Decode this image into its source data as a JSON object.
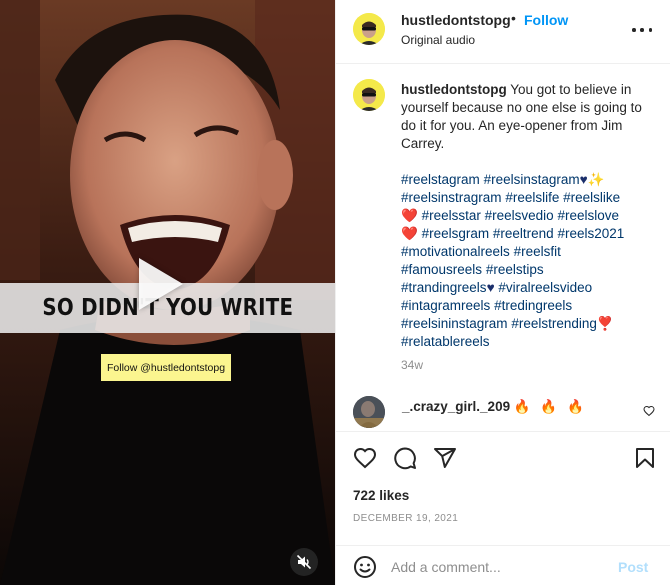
{
  "video": {
    "caption": "SO DIDN'T YOU WRITE",
    "watermark": "Follow @hustledontstopg",
    "play_icon": "play-icon",
    "mute_icon": "muted-speaker-icon"
  },
  "header": {
    "username": "hustledontstopg",
    "separator": "•",
    "follow_label": "Follow",
    "audio_label": "Original audio",
    "more_icon": "more-options-icon"
  },
  "caption": {
    "username": "hustledontstopg",
    "text": "You got to believe in yourself because no one else is going to do it for you. An eye-opener from Jim Carrey.",
    "hashtags": [
      "#reelstagram",
      "#reelsinstagram",
      "♥",
      "✨",
      "#reelsinstragram",
      "#reelslife",
      "#reelslike",
      "❤️",
      "#reelsstar",
      "#reelsvedio",
      "#reelslove",
      "❤️",
      "#reelsgram",
      "#reeltrend",
      "#reels2021",
      "#motivationalreels",
      "#reelsfit",
      "#famousreels",
      "#reelstips",
      "#trandingreels",
      "♥",
      "#viralreelsvideo",
      "#intagramreels",
      "#tredingreels",
      "#reelsininstagram",
      "#reelstrending",
      "❣️",
      "#relatablereels"
    ],
    "age": "34w"
  },
  "comment": {
    "username": "_.crazy_girl._209",
    "text": "🔥 🔥 🔥"
  },
  "actions": {
    "like_icon": "heart-icon",
    "comment_icon": "comment-icon",
    "share_icon": "share-icon",
    "save_icon": "bookmark-icon",
    "likes": "722 likes",
    "date": "DECEMBER 19, 2021"
  },
  "add_comment": {
    "emoji_icon": "emoji-icon",
    "placeholder": "Add a comment...",
    "post_label": "Post"
  },
  "colors": {
    "accent": "#0095f6",
    "hashtag": "#00376b",
    "muted_text": "#8e8e8e",
    "post_disabled": "#b2dffc",
    "watermark_bg": "#fbf58f"
  }
}
